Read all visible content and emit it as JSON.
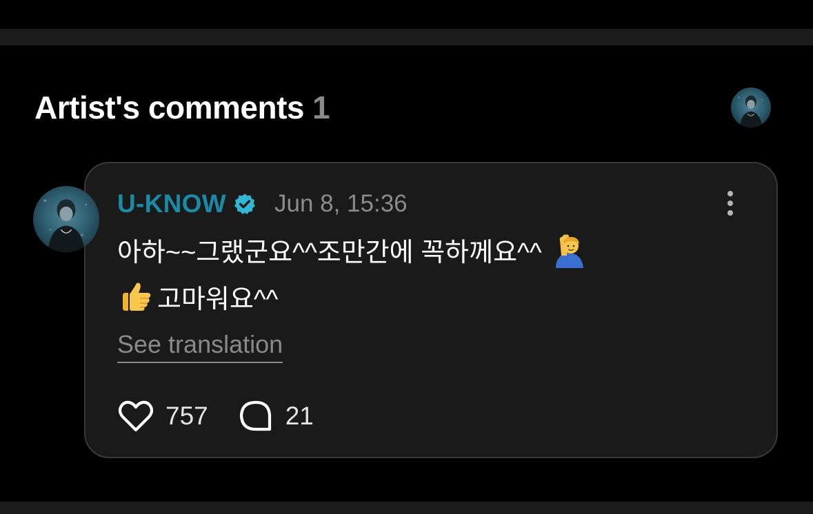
{
  "section": {
    "title": "Artist's comments",
    "count": "1"
  },
  "comment": {
    "author": "U-KNOW",
    "verified_icon": "verified-badge-icon",
    "timestamp": "Jun 8, 15:36",
    "line1": "아하~~그랬군요^^조만간에 꼭하께요^^",
    "line1_emoji": "person-raising-hand-emoji",
    "line2_emoji": "thumbs-up-emoji",
    "line2": "고마워요^^",
    "translate_label": "See translation",
    "likes": "757",
    "replies": "21"
  },
  "colors": {
    "background": "#000000",
    "card": "#1a1a1a",
    "author": "#1a8aa6",
    "muted": "#8a8a8a"
  }
}
